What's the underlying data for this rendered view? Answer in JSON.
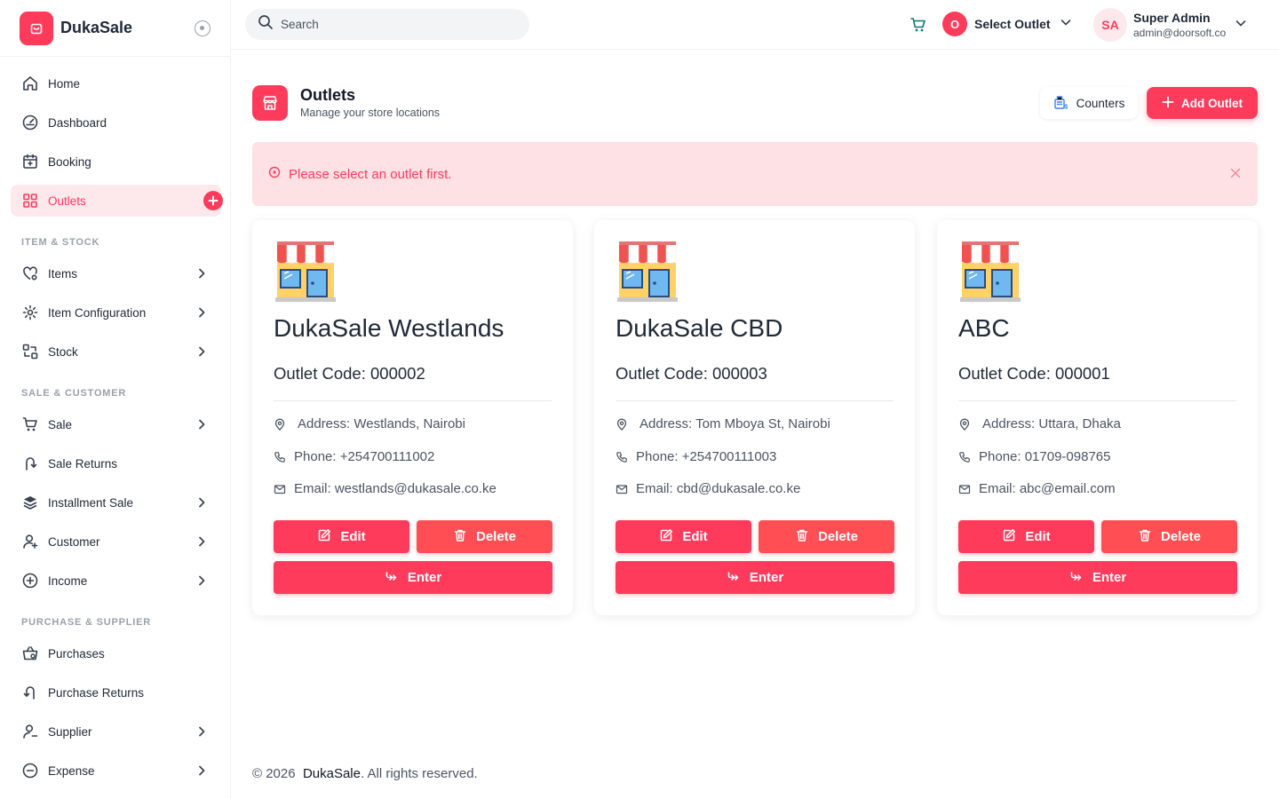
{
  "brand": {
    "name": "DukaSale",
    "accent": "#ff3b5c"
  },
  "search": {
    "placeholder": "Search"
  },
  "topbar": {
    "outlet_initial": "O",
    "outlet_label": "Select Outlet",
    "user_initials": "SA",
    "user_name": "Super Admin",
    "user_email": "admin@doorsoft.co"
  },
  "sidebar": {
    "home": "Home",
    "dashboard": "Dashboard",
    "booking": "Booking",
    "outlets": "Outlets",
    "section_item_stock": "ITEM & STOCK",
    "items": "Items",
    "item_configuration": "Item Configuration",
    "stock": "Stock",
    "section_sale_customer": "SALE & CUSTOMER",
    "sale": "Sale",
    "sale_returns": "Sale Returns",
    "installment_sale": "Installment Sale",
    "customer": "Customer",
    "income": "Income",
    "section_purchase_supplier": "PURCHASE & SUPPLIER",
    "purchases": "Purchases",
    "purchase_returns": "Purchase Returns",
    "supplier": "Supplier",
    "expense": "Expense"
  },
  "page": {
    "title": "Outlets",
    "subtitle": "Manage your store locations",
    "counters_label": "Counters",
    "add_label": "Add Outlet"
  },
  "alert": {
    "message": "Please select an outlet first."
  },
  "outlets": [
    {
      "name": "DukaSale Westlands",
      "code": "Outlet Code: 000002",
      "address": "Address: Westlands, Nairobi",
      "phone": "Phone: +254700111002",
      "email": "Email: westlands@dukasale.co.ke"
    },
    {
      "name": "DukaSale CBD",
      "code": "Outlet Code: 000003",
      "address": "Address: Tom Mboya St, Nairobi",
      "phone": "Phone: +254700111003",
      "email": "Email: cbd@dukasale.co.ke"
    },
    {
      "name": "ABC",
      "code": "Outlet Code: 000001",
      "address": "Address: Uttara, Dhaka",
      "phone": "Phone: 01709-098765",
      "email": "Email: abc@email.com"
    }
  ],
  "card_buttons": {
    "edit": "Edit",
    "delete": "Delete",
    "enter": "Enter"
  },
  "footer": {
    "year": "© 2026",
    "brand": "DukaSale",
    "suffix": ". All rights reserved."
  }
}
